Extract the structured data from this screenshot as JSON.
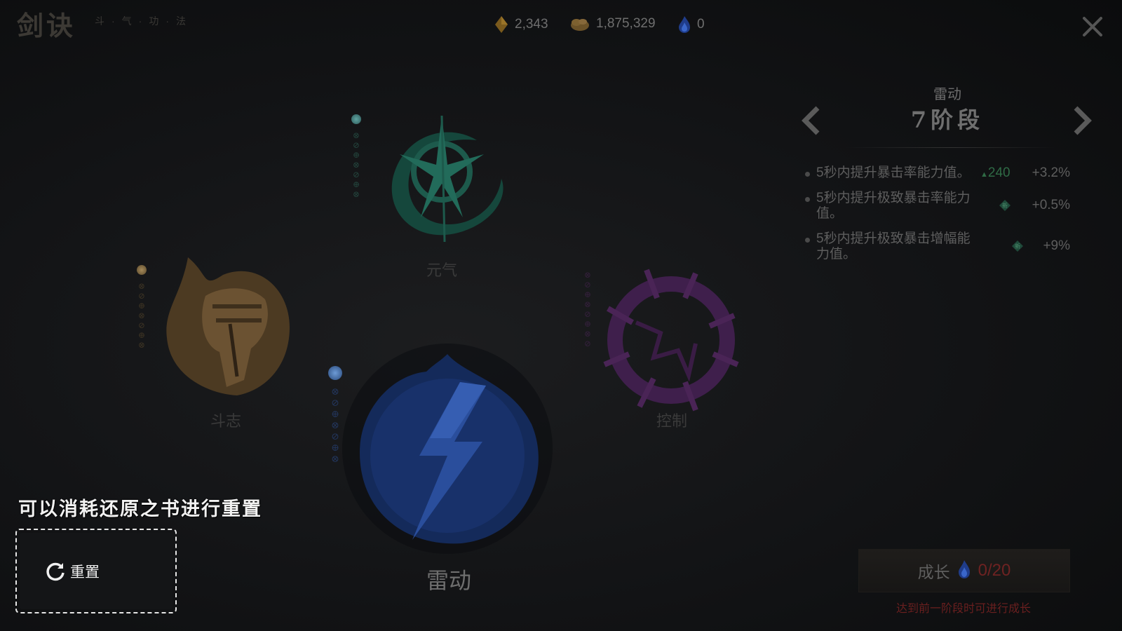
{
  "header": {
    "title": "剑诀",
    "subtitle": "斗·气·功·法",
    "currencies": [
      {
        "icon": "gold-ingot-icon",
        "value": "2,343"
      },
      {
        "icon": "coin-pouch-icon",
        "value": "1,875,329"
      },
      {
        "icon": "blue-flame-icon",
        "value": "0"
      }
    ]
  },
  "nodes": [
    {
      "id": "yuanqi",
      "label": "元气",
      "color": "#1f5a4c",
      "icon": "compass-star-icon"
    },
    {
      "id": "douzhi",
      "label": "斗志",
      "color": "#6b4e2e",
      "icon": "fist-icon"
    },
    {
      "id": "leidong",
      "label": "雷动",
      "color": "#1e3a7a",
      "icon": "lightning-orb-icon",
      "selected": true
    },
    {
      "id": "kongzhi",
      "label": "控制",
      "color": "#4a2456",
      "icon": "thorn-ring-icon"
    }
  ],
  "detail": {
    "skill_name": "雷动",
    "stage": "7阶段",
    "effects": [
      {
        "text": "5秒内提升暴击率能力值。",
        "up_value": "240",
        "bonus": "+3.2%",
        "new": false
      },
      {
        "text": "5秒内提升极致暴击率能力值。",
        "up_value": "",
        "bonus": "+0.5%",
        "new": true
      },
      {
        "text": "5秒内提升极致暴击增幅能力值。",
        "up_value": "",
        "bonus": "+9%",
        "new": true
      }
    ],
    "grow": {
      "label": "成长",
      "count": "0/20"
    },
    "grow_hint": "达到前一阶段时可进行成长"
  },
  "tutorial": {
    "hint": "可以消耗还原之书进行重置",
    "reset_label": "重置"
  },
  "colors": {
    "accent_red": "#6e2222",
    "text_light": "#f0f0f0",
    "up_green": "#2f6a45"
  }
}
